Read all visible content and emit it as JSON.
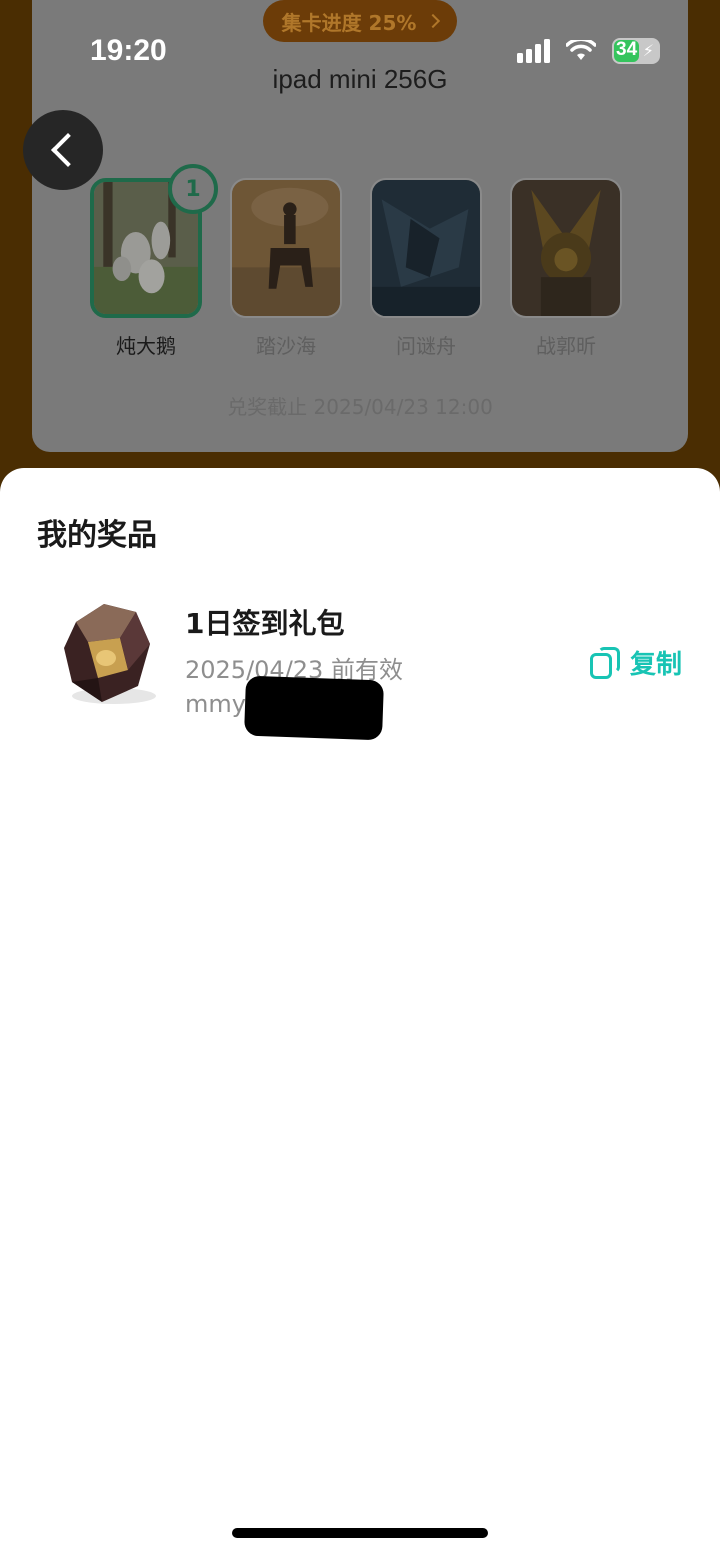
{
  "status_bar": {
    "time": "19:20",
    "battery": "34"
  },
  "header": {
    "progress_label": "集卡进度 25%",
    "title": "ipad mini 256G"
  },
  "cards": [
    {
      "label": "炖大鹅",
      "count": "1",
      "active": true
    },
    {
      "label": "踏沙海",
      "active": false
    },
    {
      "label": "问谜舟",
      "active": false
    },
    {
      "label": "战郭昕",
      "active": false
    }
  ],
  "deadline": "兑奖截止 2025/04/23 12:00",
  "sheet": {
    "title": "我的奖品",
    "prize": {
      "name": "1日签到礼包",
      "valid": "2025/04/23 前有效",
      "code": "mmy",
      "copy_label": "复制"
    }
  },
  "colors": {
    "accent": "#18c4b4",
    "active_border": "#1f6a4a",
    "pill": "#6c3c08"
  }
}
